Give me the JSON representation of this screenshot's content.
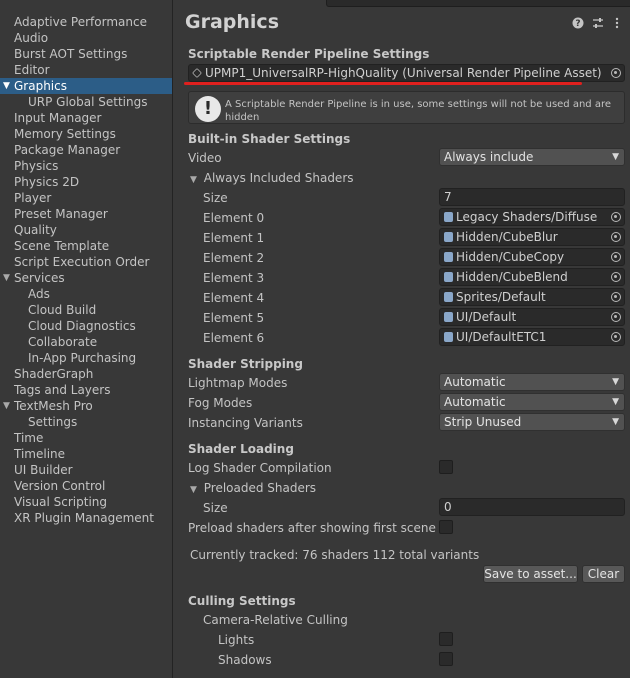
{
  "sidebar": {
    "items": [
      {
        "label": "Adaptive Performance",
        "indent": 0
      },
      {
        "label": "Audio",
        "indent": 0
      },
      {
        "label": "Burst AOT Settings",
        "indent": 0
      },
      {
        "label": "Editor",
        "indent": 0
      },
      {
        "label": "Graphics",
        "indent": 0,
        "selected": true,
        "expanded": true
      },
      {
        "label": "URP Global Settings",
        "indent": 1
      },
      {
        "label": "Input Manager",
        "indent": 0
      },
      {
        "label": "Memory Settings",
        "indent": 0
      },
      {
        "label": "Package Manager",
        "indent": 0
      },
      {
        "label": "Physics",
        "indent": 0
      },
      {
        "label": "Physics 2D",
        "indent": 0
      },
      {
        "label": "Player",
        "indent": 0
      },
      {
        "label": "Preset Manager",
        "indent": 0
      },
      {
        "label": "Quality",
        "indent": 0
      },
      {
        "label": "Scene Template",
        "indent": 0
      },
      {
        "label": "Script Execution Order",
        "indent": 0
      },
      {
        "label": "Services",
        "indent": 0,
        "expanded": true
      },
      {
        "label": "Ads",
        "indent": 1
      },
      {
        "label": "Cloud Build",
        "indent": 1
      },
      {
        "label": "Cloud Diagnostics",
        "indent": 1
      },
      {
        "label": "Collaborate",
        "indent": 1
      },
      {
        "label": "In-App Purchasing",
        "indent": 1
      },
      {
        "label": "ShaderGraph",
        "indent": 0
      },
      {
        "label": "Tags and Layers",
        "indent": 0
      },
      {
        "label": "TextMesh Pro",
        "indent": 0,
        "expanded": true
      },
      {
        "label": "Settings",
        "indent": 1
      },
      {
        "label": "Time",
        "indent": 0
      },
      {
        "label": "Timeline",
        "indent": 0
      },
      {
        "label": "UI Builder",
        "indent": 0
      },
      {
        "label": "Version Control",
        "indent": 0
      },
      {
        "label": "Visual Scripting",
        "indent": 0
      },
      {
        "label": "XR Plugin Management",
        "indent": 0
      }
    ]
  },
  "header": {
    "title": "Graphics",
    "help_icon": "help-icon",
    "preset_icon": "sliders-icon",
    "menu_icon": "kebab-menu-icon"
  },
  "srp": {
    "section_title": "Scriptable Render Pipeline Settings",
    "asset_value": "UPMP1_UniversalRP-HighQuality (Universal Render Pipeline Asset)",
    "help_text": "A Scriptable Render Pipeline is in use, some settings will not be used and are hidden"
  },
  "builtin": {
    "section_title": "Built-in Shader Settings",
    "video_label": "Video",
    "video_value": "Always include",
    "always_included_label": "Always Included Shaders",
    "size_label": "Size",
    "size_value": "7",
    "elements": [
      {
        "label": "Element 0",
        "value": "Legacy Shaders/Diffuse"
      },
      {
        "label": "Element 1",
        "value": "Hidden/CubeBlur"
      },
      {
        "label": "Element 2",
        "value": "Hidden/CubeCopy"
      },
      {
        "label": "Element 3",
        "value": "Hidden/CubeBlend"
      },
      {
        "label": "Element 4",
        "value": "Sprites/Default"
      },
      {
        "label": "Element 5",
        "value": "UI/Default"
      },
      {
        "label": "Element 6",
        "value": "UI/DefaultETC1"
      }
    ]
  },
  "stripping": {
    "section_title": "Shader Stripping",
    "lightmap_label": "Lightmap Modes",
    "lightmap_value": "Automatic",
    "fog_label": "Fog Modes",
    "fog_value": "Automatic",
    "instancing_label": "Instancing Variants",
    "instancing_value": "Strip Unused"
  },
  "loading": {
    "section_title": "Shader Loading",
    "log_label": "Log Shader Compilation",
    "preloaded_label": "Preloaded Shaders",
    "size_label": "Size",
    "size_value": "0",
    "preload_after_label": "Preload shaders after showing first scene",
    "tracked_text": "Currently tracked: 76 shaders 112 total variants",
    "save_button": "Save to asset...",
    "clear_button": "Clear"
  },
  "culling": {
    "section_title": "Culling Settings",
    "camera_relative_label": "Camera-Relative Culling",
    "lights_label": "Lights",
    "shadows_label": "Shadows"
  },
  "colors": {
    "selection": "#2c5d87",
    "annotation_red": "#e0201e",
    "panel_bg": "#383838",
    "field_bg": "#2a2a2a"
  }
}
